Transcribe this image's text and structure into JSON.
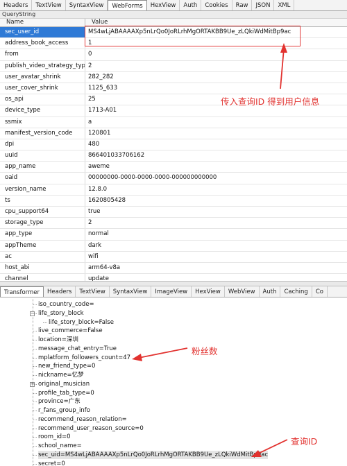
{
  "top_tabs": [
    "Headers",
    "TextView",
    "SyntaxView",
    "WebForms",
    "HexView",
    "Auth",
    "Cookies",
    "Raw",
    "JSON",
    "XML"
  ],
  "top_active": "WebForms",
  "querystring_label": "QueryString",
  "grid_headers": {
    "name": "Name",
    "value": "Value"
  },
  "rows": [
    {
      "name": "sec_user_id",
      "value": "MS4wLjABAAAAXp5nLrQo0JoRLrhMgORTAKBB9Ue_zLQkiWdMitBp9ac"
    },
    {
      "name": "address_book_access",
      "value": "1"
    },
    {
      "name": "from",
      "value": "0"
    },
    {
      "name": "publish_video_strategy_type",
      "value": "2"
    },
    {
      "name": "user_avatar_shrink",
      "value": "282_282"
    },
    {
      "name": "user_cover_shrink",
      "value": "1125_633"
    },
    {
      "name": "os_api",
      "value": "25"
    },
    {
      "name": "device_type",
      "value": "1713-A01"
    },
    {
      "name": "ssmix",
      "value": "a"
    },
    {
      "name": "manifest_version_code",
      "value": "120801"
    },
    {
      "name": "dpi",
      "value": "480"
    },
    {
      "name": "uuid",
      "value": "866401033706162"
    },
    {
      "name": "app_name",
      "value": "aweme"
    },
    {
      "name": "oaid",
      "value": "00000000-0000-0000-0000-000000000000"
    },
    {
      "name": "version_name",
      "value": "12.8.0"
    },
    {
      "name": "ts",
      "value": "1620805428"
    },
    {
      "name": "cpu_support64",
      "value": "true"
    },
    {
      "name": "storage_type",
      "value": "2"
    },
    {
      "name": "app_type",
      "value": "normal"
    },
    {
      "name": "appTheme",
      "value": "dark"
    },
    {
      "name": "ac",
      "value": "wifi"
    },
    {
      "name": "host_abi",
      "value": "arm64-v8a"
    },
    {
      "name": "channel",
      "value": "update"
    }
  ],
  "bottom_tabs": [
    "Transformer",
    "Headers",
    "TextView",
    "SyntaxView",
    "ImageView",
    "HexView",
    "WebView",
    "Auth",
    "Caching",
    "Co"
  ],
  "bottom_active": "Transformer",
  "tree_items": [
    "iso_country_code=",
    "life_story_block",
    "life_story_block=False",
    "live_commerce=False",
    "location=深圳",
    "message_chat_entry=True",
    "mplatform_followers_count=47",
    "new_friend_type=0",
    "nickname=忆梦",
    "original_musician",
    "profile_tab_type=0",
    "province=广东",
    "r_fans_group_info",
    "recommend_reason_relation=",
    "recommend_user_reason_source=0",
    "room_id=0",
    "school_name=",
    "sec_uid=MS4wLjABAAAAXp5nLrQo0JoRLrhMgORTAKBB9Ue_zLQkiWdMitBp9ac",
    "secret=0"
  ],
  "annotations": {
    "pass_query": "传入查询ID 得到用户信息",
    "followers": "粉丝数",
    "query_id": "查询ID"
  },
  "colors": {
    "annotation": "#e2322f",
    "selection": "#2f7ad6"
  }
}
